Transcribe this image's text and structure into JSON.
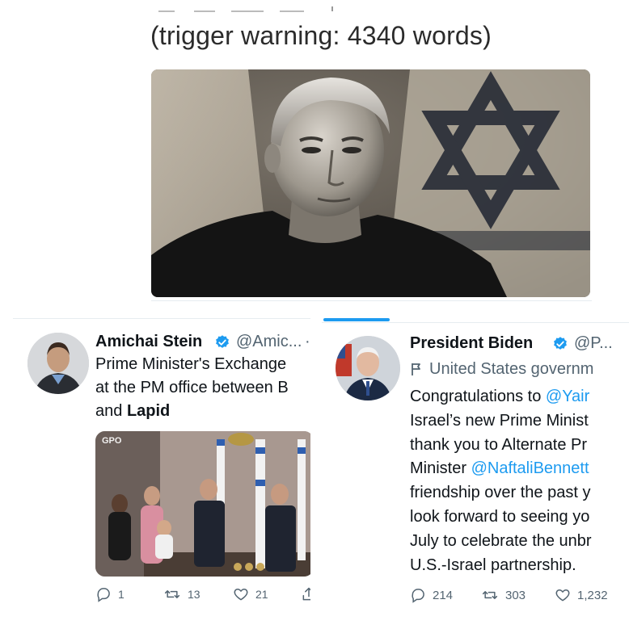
{
  "caption": "(trigger warning: 4340 words)",
  "tweet_left": {
    "name": "Amichai Stein",
    "handle": "@Amic...",
    "dot": "·",
    "body_line1": "Prime Minister's Exchange",
    "body_line2": "at the PM office between B",
    "body_line3_pre": "and ",
    "body_line3_bold": "Lapid",
    "media_watermark": "GPO",
    "replies": "1",
    "retweets": "13",
    "likes": "21"
  },
  "tweet_right": {
    "name": "President Biden",
    "handle": "@P...",
    "label": "United States governm",
    "line1_pre": "Congratulations to ",
    "line1_mention": "@Yair",
    "line2": "Israel’s new Prime Minist",
    "line3": "thank you to Alternate Pr",
    "line4_pre": "Minister ",
    "line4_mention": "@NaftaliBennett",
    "line5": "friendship over the past y",
    "line6": "look forward to seeing yo",
    "line7": "July to celebrate the unbr",
    "line8": "U.S.-Israel partnership.",
    "replies": "214",
    "retweets": "303",
    "likes": "1,232"
  },
  "colors": {
    "link": "#1d9bf0",
    "muted": "#536471",
    "text": "#0f1419",
    "verified": "#1d9bf0"
  }
}
